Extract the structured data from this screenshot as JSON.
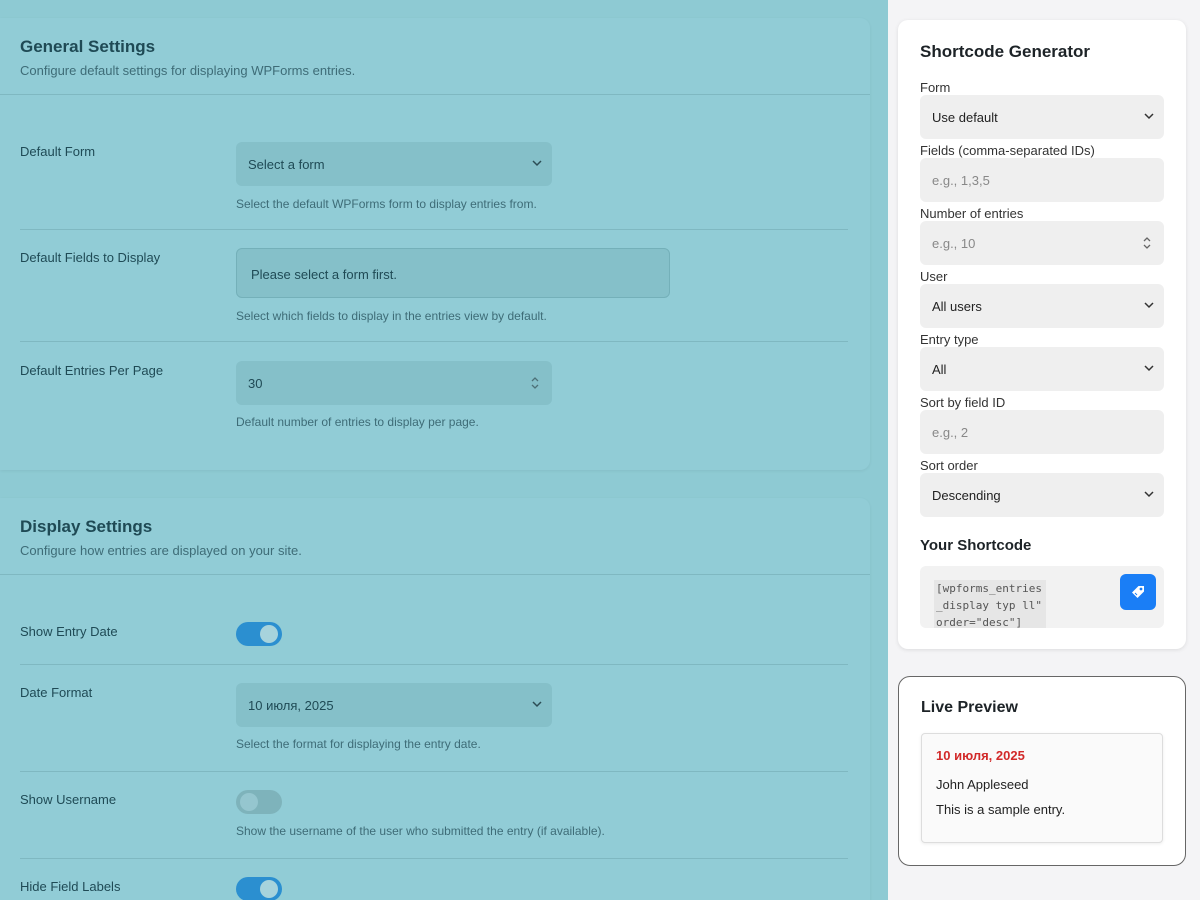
{
  "general": {
    "title": "General Settings",
    "subtitle": "Configure default settings for displaying WPForms entries.",
    "default_form": {
      "label": "Default Form",
      "value": "Select a form",
      "help": "Select the default WPForms form to display entries from."
    },
    "default_fields": {
      "label": "Default Fields to Display",
      "value": "Please select a form first.",
      "help": "Select which fields to display in the entries view by default."
    },
    "per_page": {
      "label": "Default Entries Per Page",
      "value": "30",
      "help": "Default number of entries to display per page."
    }
  },
  "display": {
    "title": "Display Settings",
    "subtitle": "Configure how entries are displayed on your site.",
    "show_date": {
      "label": "Show Entry Date",
      "on": true
    },
    "date_format": {
      "label": "Date Format",
      "value": "10 июля, 2025",
      "help": "Select the format for displaying the entry date."
    },
    "show_username": {
      "label": "Show Username",
      "on": false,
      "help": "Show the username of the user who submitted the entry (if available)."
    },
    "hide_labels": {
      "label": "Hide Field Labels",
      "on": true
    }
  },
  "generator": {
    "title": "Shortcode Generator",
    "form": {
      "label": "Form",
      "value": "Use default"
    },
    "fields": {
      "label": "Fields (comma-separated IDs)",
      "placeholder": "e.g., 1,3,5"
    },
    "entries": {
      "label": "Number of entries",
      "placeholder": "e.g., 10"
    },
    "user": {
      "label": "User",
      "value": "All users"
    },
    "entry_type": {
      "label": "Entry type",
      "value": "All"
    },
    "sort_field": {
      "label": "Sort by field ID",
      "placeholder": "e.g., 2"
    },
    "sort_order": {
      "label": "Sort order",
      "value": "Descending"
    },
    "shortcode_title": "Your Shortcode",
    "shortcode": "[wpforms_entries_display typ ll\" order=\"desc\"]"
  },
  "preview": {
    "title": "Live Preview",
    "date": "10 июля, 2025",
    "name": "John Appleseed",
    "text": "This is a sample entry."
  },
  "colors": {
    "accent": "#1a7ef6",
    "preview_date": "#d22a2a",
    "toggle_on": "#2b8fd0"
  }
}
